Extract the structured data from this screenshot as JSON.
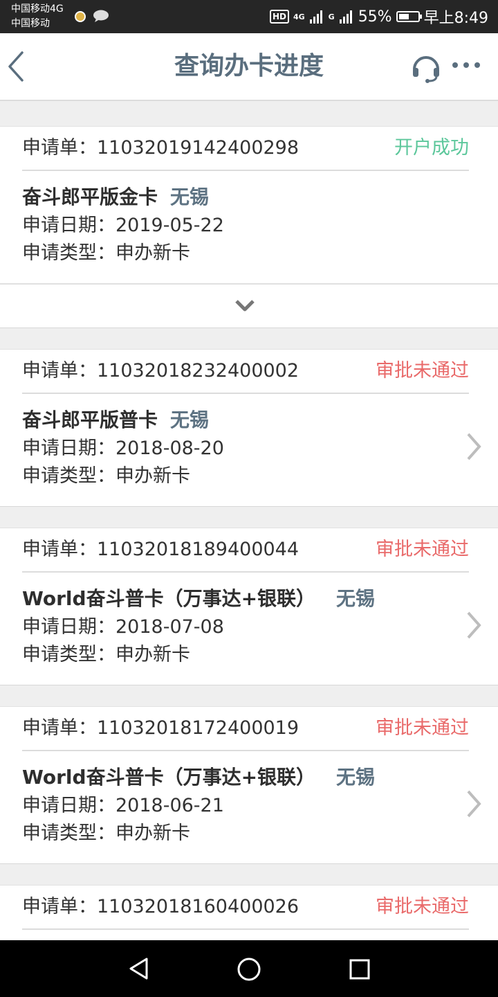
{
  "status_bar": {
    "carrier_1": "中国移动4G",
    "carrier_2": "中国移动",
    "hd": "HD",
    "net_1": "4G",
    "net_2": "G",
    "battery_pct": "55%",
    "battery_level": 0.55,
    "time": "早上8:49"
  },
  "header": {
    "title": "查询办卡进度",
    "back_icon": "chevron-left-icon",
    "service_icon": "headset-icon",
    "more_icon": "more-dots-icon"
  },
  "labels": {
    "app_no": "申请单：",
    "date": "申请日期：",
    "type": "申请类型："
  },
  "colors": {
    "success": "#5cc79b",
    "failed": "#e96a6a",
    "title": "#5a6e7e"
  },
  "applications": [
    {
      "number": "11032019142400298",
      "status": "开户成功",
      "card_name": "奋斗郎平版金卡",
      "city": "无锡",
      "date": "2019-05-22",
      "type": "申办新卡"
    },
    {
      "number": "11032018232400002",
      "status": "审批未通过",
      "card_name": "奋斗郎平版普卡",
      "city": "无锡",
      "date": "2018-08-20",
      "type": "申办新卡"
    },
    {
      "number": "11032018189400044",
      "status": "审批未通过",
      "card_name": "World奋斗普卡（万事达+银联）",
      "city": "无锡",
      "date": "2018-07-08",
      "type": "申办新卡"
    },
    {
      "number": "11032018172400019",
      "status": "审批未通过",
      "card_name": "World奋斗普卡（万事达+银联）",
      "city": "无锡",
      "date": "2018-06-21",
      "type": "申办新卡"
    },
    {
      "number": "11032018160400026",
      "status": "审批未通过"
    }
  ]
}
